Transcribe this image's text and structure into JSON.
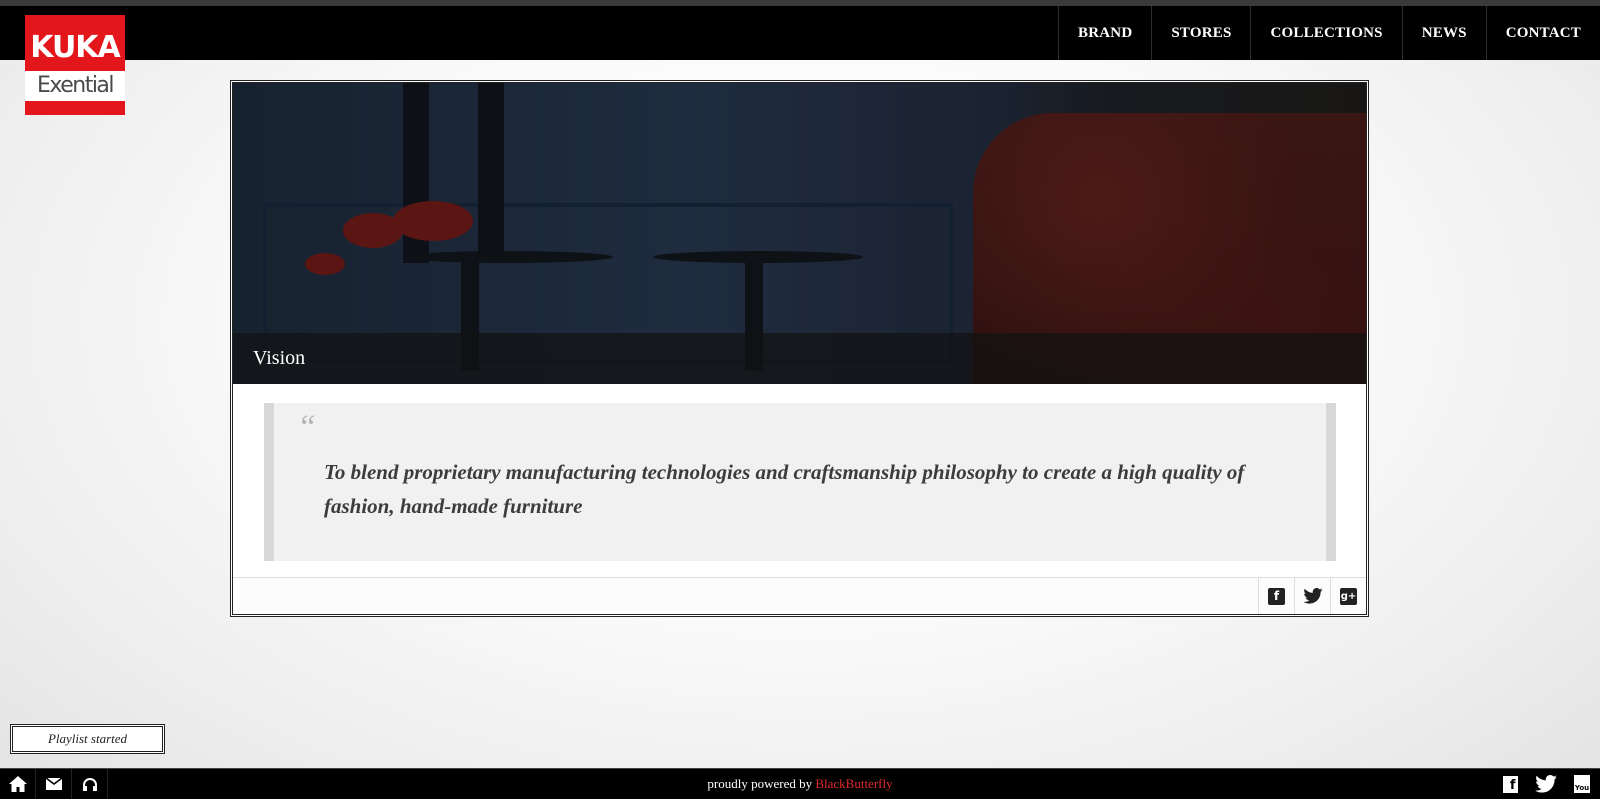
{
  "logo": {
    "line1": "KUKA",
    "line2": "Exential"
  },
  "nav": {
    "items": [
      {
        "label": "BRAND"
      },
      {
        "label": "STORES"
      },
      {
        "label": "COLLECTIONS"
      },
      {
        "label": "NEWS"
      },
      {
        "label": "CONTACT"
      }
    ]
  },
  "hero": {
    "title": "Vision"
  },
  "quote": {
    "mark": "“",
    "text": "To blend proprietary manufacturing technologies and craftsmanship philosophy to create a high quality of fashion, hand-made furniture"
  },
  "share": {
    "icons": [
      "facebook-icon",
      "twitter-icon",
      "google-plus-icon"
    ],
    "facebook_glyph": "f",
    "google_glyph": "g+"
  },
  "toast": {
    "text": "Playlist started"
  },
  "footer": {
    "powered_prefix": "proudly powered by",
    "powered_link": "BlackButterfly",
    "left_icons": [
      "home-icon",
      "mail-icon",
      "headphones-icon"
    ],
    "right_icons": [
      "facebook-icon",
      "twitter-icon",
      "youtube-icon"
    ],
    "youtube_glyph": "You"
  },
  "colors": {
    "accent": "#e22b2b",
    "logo_red": "#e3161b",
    "bar": "#000000"
  }
}
